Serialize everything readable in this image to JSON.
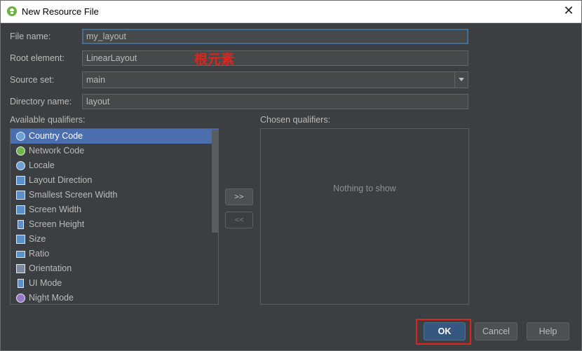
{
  "window": {
    "title": "New Resource File"
  },
  "form": {
    "file_name": {
      "label": "File name:",
      "value": "my_layout"
    },
    "root_element": {
      "label": "Root element:",
      "value": "LinearLayout"
    },
    "source_set": {
      "label": "Source set:",
      "value": "main"
    },
    "directory_name": {
      "label": "Directory name:",
      "value": "layout"
    }
  },
  "annotation": {
    "text": "根元素",
    "color": "#e0241b"
  },
  "available": {
    "label": "Available qualifiers:",
    "items": [
      {
        "label": "Country Code",
        "icon": "globe-icon"
      },
      {
        "label": "Network Code",
        "icon": "network-icon"
      },
      {
        "label": "Locale",
        "icon": "globe-icon"
      },
      {
        "label": "Layout Direction",
        "icon": "layout-direction-icon"
      },
      {
        "label": "Smallest Screen Width",
        "icon": "width-icon"
      },
      {
        "label": "Screen Width",
        "icon": "width-icon"
      },
      {
        "label": "Screen Height",
        "icon": "height-icon"
      },
      {
        "label": "Size",
        "icon": "size-icon"
      },
      {
        "label": "Ratio",
        "icon": "ratio-icon"
      },
      {
        "label": "Orientation",
        "icon": "orientation-icon"
      },
      {
        "label": "UI Mode",
        "icon": "device-icon"
      },
      {
        "label": "Night Mode",
        "icon": "moon-icon"
      }
    ],
    "selected_index": 0
  },
  "transfer": {
    "add_label": ">>",
    "remove_label": "<<"
  },
  "chosen": {
    "label": "Chosen qualifiers:",
    "empty_text": "Nothing to show"
  },
  "buttons": {
    "ok": "OK",
    "cancel": "Cancel",
    "help": "Help"
  },
  "colors": {
    "background": "#3c3f41",
    "selection": "#4b6eaf",
    "focus_border": "#466d94",
    "default_button": "#365880",
    "highlight_box": "#e0241b"
  }
}
